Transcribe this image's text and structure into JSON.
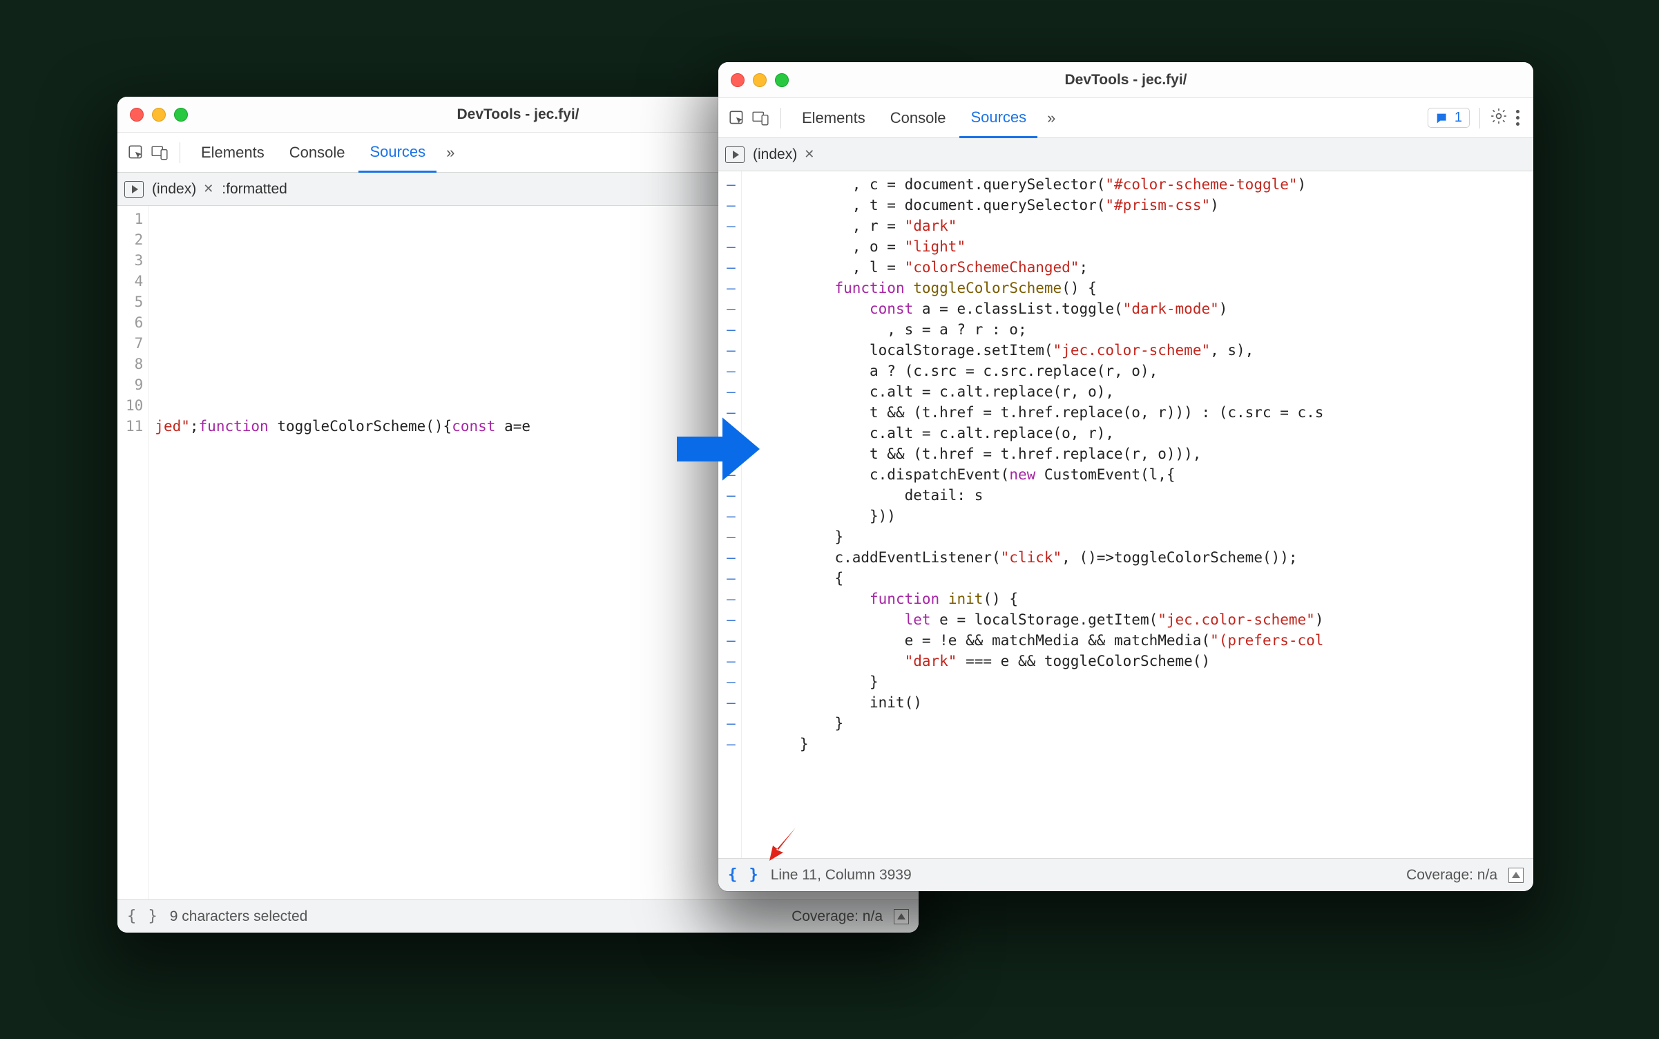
{
  "left": {
    "title": "DevTools - jec.fyi/",
    "tabs": [
      "Elements",
      "Console",
      "Sources"
    ],
    "active_tab": "Sources",
    "overflow": "»",
    "files": [
      {
        "name": "(index)"
      },
      {
        "name": ":formatted"
      }
    ],
    "gutter": [
      "1",
      "2",
      "3",
      "4",
      "5",
      "6",
      "7",
      "8",
      "9",
      "10",
      "11"
    ],
    "line11_pre": "jed\"",
    "line11_kw1": "function",
    "line11_fn": " toggleColorScheme(){",
    "line11_kw2": "const",
    "line11_tail": " a=e",
    "footer_status": "9 characters selected",
    "coverage": "Coverage: n/a",
    "braces": "{ }"
  },
  "right": {
    "title": "DevTools - jec.fyi/",
    "tabs": [
      "Elements",
      "Console",
      "Sources"
    ],
    "active_tab": "Sources",
    "overflow": "»",
    "issues_count": "1",
    "files": [
      {
        "name": "(index)"
      }
    ],
    "code_lines": [
      {
        "indent": "            , ",
        "pieces": [
          [
            "p",
            "c = document.querySelector("
          ],
          [
            "s",
            "\"#color-scheme-toggle\""
          ],
          [
            "p",
            ")"
          ]
        ]
      },
      {
        "indent": "            , ",
        "pieces": [
          [
            "p",
            "t = document.querySelector("
          ],
          [
            "s",
            "\"#prism-css\""
          ],
          [
            "p",
            ")"
          ]
        ]
      },
      {
        "indent": "            , ",
        "pieces": [
          [
            "p",
            "r = "
          ],
          [
            "s",
            "\"dark\""
          ]
        ]
      },
      {
        "indent": "            , ",
        "pieces": [
          [
            "p",
            "o = "
          ],
          [
            "s",
            "\"light\""
          ]
        ]
      },
      {
        "indent": "            , ",
        "pieces": [
          [
            "p",
            "l = "
          ],
          [
            "s",
            "\"colorSchemeChanged\""
          ],
          [
            "p",
            ";"
          ]
        ]
      },
      {
        "indent": "          ",
        "pieces": [
          [
            "k",
            "function"
          ],
          [
            "p",
            " "
          ],
          [
            "f",
            "toggleColorScheme"
          ],
          [
            "p",
            "() {"
          ]
        ]
      },
      {
        "indent": "              ",
        "pieces": [
          [
            "k",
            "const"
          ],
          [
            "p",
            " a = e.classList.toggle("
          ],
          [
            "s",
            "\"dark-mode\""
          ],
          [
            "p",
            ")"
          ]
        ]
      },
      {
        "indent": "                , ",
        "pieces": [
          [
            "p",
            "s = a ? r : o;"
          ]
        ]
      },
      {
        "indent": "              ",
        "pieces": [
          [
            "p",
            "localStorage.setItem("
          ],
          [
            "s",
            "\"jec.color-scheme\""
          ],
          [
            "p",
            ", s),"
          ]
        ]
      },
      {
        "indent": "              ",
        "pieces": [
          [
            "p",
            "a ? (c.src = c.src.replace(r, o),"
          ]
        ]
      },
      {
        "indent": "              ",
        "pieces": [
          [
            "p",
            "c.alt = c.alt.replace(r, o),"
          ]
        ]
      },
      {
        "indent": "              ",
        "pieces": [
          [
            "p",
            "t && (t.href = t.href.replace(o, r))) : (c.src = c.s"
          ]
        ]
      },
      {
        "indent": "              ",
        "pieces": [
          [
            "p",
            "c.alt = c.alt.replace(o, r),"
          ]
        ]
      },
      {
        "indent": "              ",
        "pieces": [
          [
            "p",
            "t && (t.href = t.href.replace(r, o))),"
          ]
        ]
      },
      {
        "indent": "              ",
        "pieces": [
          [
            "p",
            "c.dispatchEvent("
          ],
          [
            "k",
            "new"
          ],
          [
            "p",
            " CustomEvent(l,{"
          ]
        ]
      },
      {
        "indent": "                  ",
        "pieces": [
          [
            "p",
            "detail: s"
          ]
        ]
      },
      {
        "indent": "              ",
        "pieces": [
          [
            "p",
            "}))"
          ]
        ]
      },
      {
        "indent": "          ",
        "pieces": [
          [
            "p",
            "}"
          ]
        ]
      },
      {
        "indent": "          ",
        "pieces": [
          [
            "p",
            "c.addEventListener("
          ],
          [
            "s",
            "\"click\""
          ],
          [
            "p",
            ", ()=>toggleColorScheme());"
          ]
        ]
      },
      {
        "indent": "          ",
        "pieces": [
          [
            "p",
            "{"
          ]
        ]
      },
      {
        "indent": "              ",
        "pieces": [
          [
            "k",
            "function"
          ],
          [
            "p",
            " "
          ],
          [
            "f",
            "init"
          ],
          [
            "p",
            "() {"
          ]
        ]
      },
      {
        "indent": "                  ",
        "pieces": [
          [
            "k",
            "let"
          ],
          [
            "p",
            " e = localStorage.getItem("
          ],
          [
            "s",
            "\"jec.color-scheme\""
          ],
          [
            "p",
            ")"
          ]
        ]
      },
      {
        "indent": "                  ",
        "pieces": [
          [
            "p",
            "e = !e && matchMedia && matchMedia("
          ],
          [
            "s",
            "\"(prefers-col"
          ]
        ]
      },
      {
        "indent": "                  ",
        "pieces": [
          [
            "s",
            "\"dark\""
          ],
          [
            "p",
            " === e && toggleColorScheme()"
          ]
        ]
      },
      {
        "indent": "              ",
        "pieces": [
          [
            "p",
            "}"
          ]
        ]
      },
      {
        "indent": "              ",
        "pieces": [
          [
            "p",
            "init()"
          ]
        ]
      },
      {
        "indent": "          ",
        "pieces": [
          [
            "p",
            "}"
          ]
        ]
      },
      {
        "indent": "      ",
        "pieces": [
          [
            "p",
            "}"
          ]
        ]
      }
    ],
    "footer_status": "Line 11, Column 3939",
    "coverage": "Coverage: n/a",
    "braces": "{ }"
  }
}
